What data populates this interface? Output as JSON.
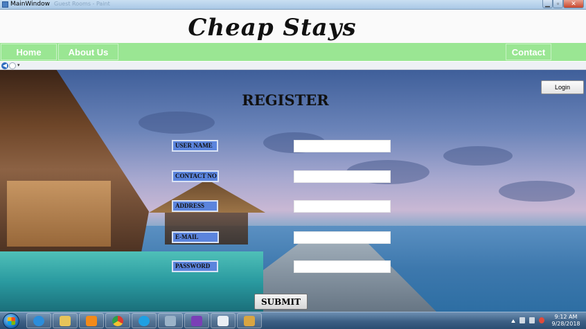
{
  "window": {
    "title": "MainWindow",
    "ghost_title": "Guest Rooms - Paint",
    "min_symbol": "▁",
    "max_symbol": "▫",
    "close_symbol": "✕"
  },
  "header": {
    "brand": "Cheap Stays"
  },
  "nav": {
    "home": "Home",
    "about": "About Us",
    "contact": "Contact Us"
  },
  "toolbar": {
    "back_symbol": "◀",
    "drop_symbol": "▾"
  },
  "login_button": "Login",
  "form": {
    "title": "REGISTER",
    "fields": [
      {
        "label": "USER NAME",
        "value": ""
      },
      {
        "label": "CONTACT NO",
        "value": ""
      },
      {
        "label": "ADDRESS",
        "value": ""
      },
      {
        "label": "E-MAIL",
        "value": ""
      },
      {
        "label": "PASSWORD",
        "value": ""
      }
    ],
    "submit": "SUBMIT"
  },
  "taskbar": {
    "apps": [
      "internet-explorer",
      "file-explorer",
      "media-player",
      "chrome",
      "skype",
      "tools",
      "visual-studio",
      "notepad",
      "paint"
    ],
    "time": "9:12 AM",
    "date": "9/28/2018",
    "colors": {
      "ie": "#2b8ddb",
      "explorer": "#e7c45a",
      "media": "#f28a1a",
      "chrome": "#dc3b2f",
      "skype": "#1fa0e3",
      "tools": "#9bb3c8",
      "vs": "#7a3fb6",
      "notepad": "#e9eef4",
      "paint": "#d9a542"
    }
  }
}
